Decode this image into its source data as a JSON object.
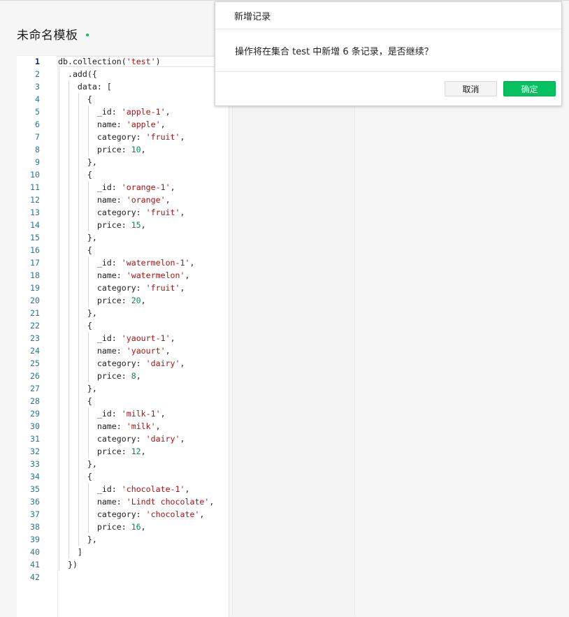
{
  "page": {
    "title": "未命名模板",
    "status_color": "#07c160"
  },
  "editor": {
    "active_line": 1,
    "lines": [
      [
        {
          "t": "db.collection("
        },
        {
          "t": "'test'",
          "c": "str"
        },
        {
          "t": ")"
        }
      ],
      [
        {
          "t": "  .add({"
        }
      ],
      [
        {
          "t": "    data: ["
        }
      ],
      [
        {
          "t": "      {"
        }
      ],
      [
        {
          "t": "        _id: "
        },
        {
          "t": "'apple-1'",
          "c": "str"
        },
        {
          "t": ","
        }
      ],
      [
        {
          "t": "        name: "
        },
        {
          "t": "'apple'",
          "c": "str"
        },
        {
          "t": ","
        }
      ],
      [
        {
          "t": "        category: "
        },
        {
          "t": "'fruit'",
          "c": "str"
        },
        {
          "t": ","
        }
      ],
      [
        {
          "t": "        price: "
        },
        {
          "t": "10",
          "c": "num"
        },
        {
          "t": ","
        }
      ],
      [
        {
          "t": "      },"
        }
      ],
      [
        {
          "t": "      {"
        }
      ],
      [
        {
          "t": "        _id: "
        },
        {
          "t": "'orange-1'",
          "c": "str"
        },
        {
          "t": ","
        }
      ],
      [
        {
          "t": "        name: "
        },
        {
          "t": "'orange'",
          "c": "str"
        },
        {
          "t": ","
        }
      ],
      [
        {
          "t": "        category: "
        },
        {
          "t": "'fruit'",
          "c": "str"
        },
        {
          "t": ","
        }
      ],
      [
        {
          "t": "        price: "
        },
        {
          "t": "15",
          "c": "num"
        },
        {
          "t": ","
        }
      ],
      [
        {
          "t": "      },"
        }
      ],
      [
        {
          "t": "      {"
        }
      ],
      [
        {
          "t": "        _id: "
        },
        {
          "t": "'watermelon-1'",
          "c": "str"
        },
        {
          "t": ","
        }
      ],
      [
        {
          "t": "        name: "
        },
        {
          "t": "'watermelon'",
          "c": "str"
        },
        {
          "t": ","
        }
      ],
      [
        {
          "t": "        category: "
        },
        {
          "t": "'fruit'",
          "c": "str"
        },
        {
          "t": ","
        }
      ],
      [
        {
          "t": "        price: "
        },
        {
          "t": "20",
          "c": "num"
        },
        {
          "t": ","
        }
      ],
      [
        {
          "t": "      },"
        }
      ],
      [
        {
          "t": "      {"
        }
      ],
      [
        {
          "t": "        _id: "
        },
        {
          "t": "'yaourt-1'",
          "c": "str"
        },
        {
          "t": ","
        }
      ],
      [
        {
          "t": "        name: "
        },
        {
          "t": "'yaourt'",
          "c": "str"
        },
        {
          "t": ","
        }
      ],
      [
        {
          "t": "        category: "
        },
        {
          "t": "'dairy'",
          "c": "str"
        },
        {
          "t": ","
        }
      ],
      [
        {
          "t": "        price: "
        },
        {
          "t": "8",
          "c": "num"
        },
        {
          "t": ","
        }
      ],
      [
        {
          "t": "      },"
        }
      ],
      [
        {
          "t": "      {"
        }
      ],
      [
        {
          "t": "        _id: "
        },
        {
          "t": "'milk-1'",
          "c": "str"
        },
        {
          "t": ","
        }
      ],
      [
        {
          "t": "        name: "
        },
        {
          "t": "'milk'",
          "c": "str"
        },
        {
          "t": ","
        }
      ],
      [
        {
          "t": "        category: "
        },
        {
          "t": "'dairy'",
          "c": "str"
        },
        {
          "t": ","
        }
      ],
      [
        {
          "t": "        price: "
        },
        {
          "t": "12",
          "c": "num"
        },
        {
          "t": ","
        }
      ],
      [
        {
          "t": "      },"
        }
      ],
      [
        {
          "t": "      {"
        }
      ],
      [
        {
          "t": "        _id: "
        },
        {
          "t": "'chocolate-1'",
          "c": "str"
        },
        {
          "t": ","
        }
      ],
      [
        {
          "t": "        name: "
        },
        {
          "t": "'Lindt chocolate'",
          "c": "str"
        },
        {
          "t": ","
        }
      ],
      [
        {
          "t": "        category: "
        },
        {
          "t": "'chocolate'",
          "c": "str"
        },
        {
          "t": ","
        }
      ],
      [
        {
          "t": "        price: "
        },
        {
          "t": "16",
          "c": "num"
        },
        {
          "t": ","
        }
      ],
      [
        {
          "t": "      },"
        }
      ],
      [
        {
          "t": "    ]"
        }
      ],
      [
        {
          "t": "  })"
        }
      ],
      [
        {
          "t": ""
        }
      ]
    ]
  },
  "dialog": {
    "title": "新增记录",
    "message": "操作将在集合 test 中新增 6 条记录，是否继续？",
    "cancel_label": "取消",
    "confirm_label": "确定"
  }
}
